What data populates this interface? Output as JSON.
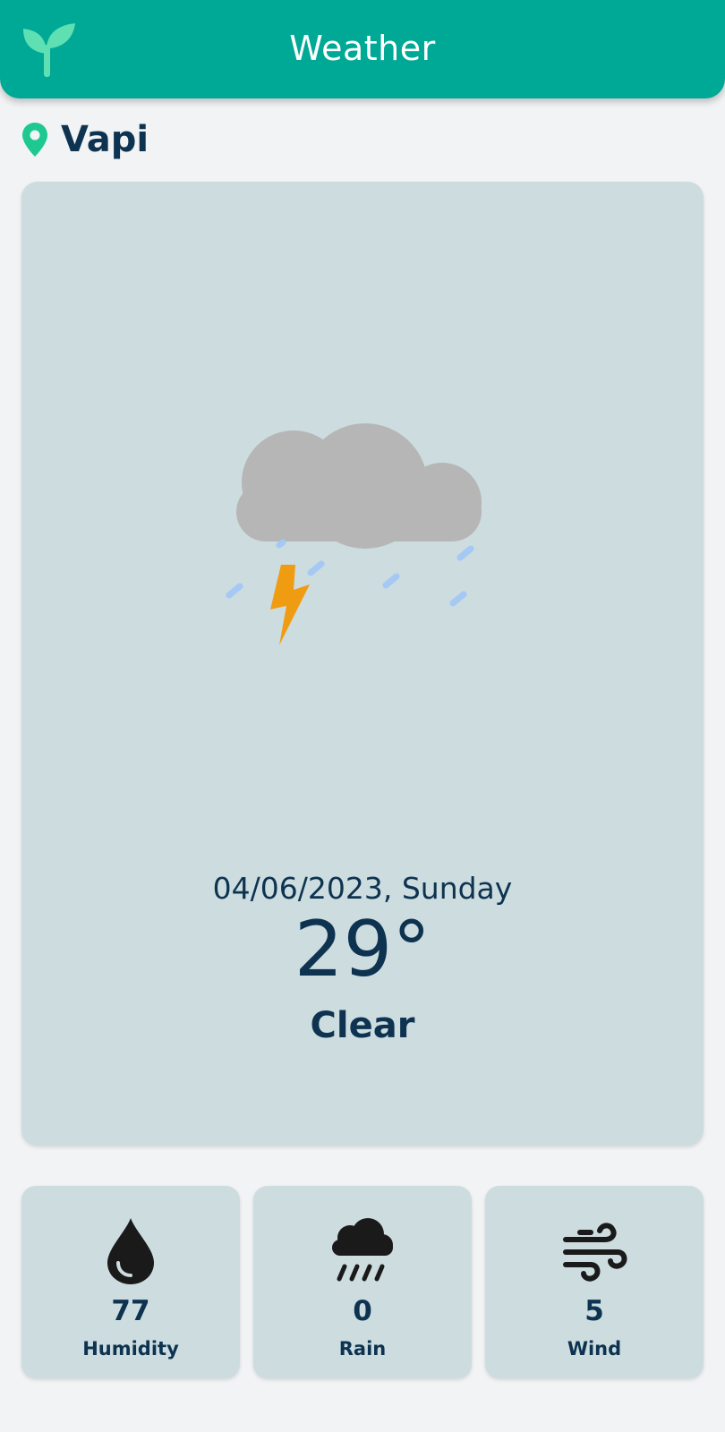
{
  "header": {
    "title": "Weather",
    "logo_icon": "sprout-icon",
    "brand_color": "#00a896"
  },
  "location": {
    "icon": "location-pin-icon",
    "city": "Vapi",
    "pin_color": "#1ec98f"
  },
  "current": {
    "illustration": "thunderstorm-rain-icon",
    "date": "04/06/2023, Sunday",
    "temperature": "29°",
    "condition": "Clear"
  },
  "stats": [
    {
      "icon": "water-drop-icon",
      "value": "77",
      "label": "Humidity"
    },
    {
      "icon": "rain-cloud-icon",
      "value": "0",
      "label": "Rain"
    },
    {
      "icon": "wind-icon",
      "value": "5",
      "label": "Wind"
    }
  ],
  "colors": {
    "background": "#f1f3f5",
    "card": "#ccdcdf",
    "text": "#0d3350",
    "cloud": "#b6b6b6",
    "bolt": "#f09c12",
    "raindrop": "#a5c8f5"
  }
}
